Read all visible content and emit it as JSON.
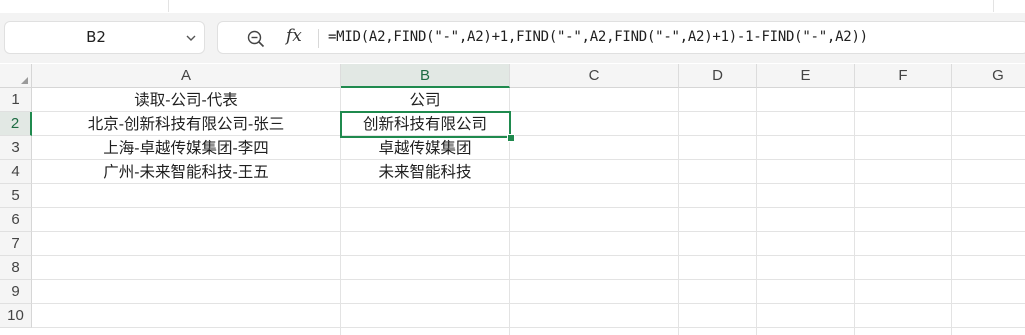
{
  "name_box": {
    "value": "B2"
  },
  "formula_bar": {
    "fx_label": "fx",
    "formula": "=MID(A2,FIND(\"-\",A2)+1,FIND(\"-\",A2,FIND(\"-\",A2)+1)-1-FIND(\"-\",A2))"
  },
  "sheet": {
    "columns": [
      "A",
      "B",
      "C",
      "D",
      "E",
      "F",
      "G"
    ],
    "rows": [
      "1",
      "2",
      "3",
      "4",
      "5",
      "6",
      "7",
      "8",
      "9",
      "10"
    ],
    "active_cell": "B2",
    "cells": {
      "A1": "读取-公司-代表",
      "A2": "北京-创新科技有限公司-张三",
      "A3": "上海-卓越传媒集团-李四",
      "A4": "广州-未来智能科技-王五",
      "B1": "公司",
      "B2": "创新科技有限公司",
      "B3": "卓越传媒集团",
      "B4": "未来智能科技"
    }
  },
  "colors": {
    "accent": "#1f8a4e",
    "header_bg": "#f5f5f5",
    "selected_header_bg": "#e2e8e4",
    "formula_bar_bg": "#f3f3f3"
  }
}
